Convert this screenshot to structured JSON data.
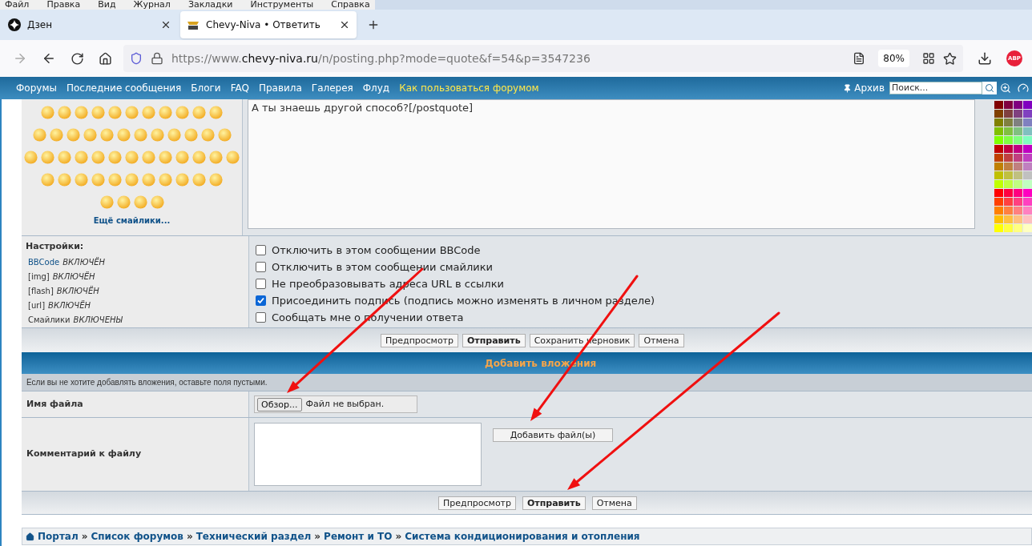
{
  "browser": {
    "menu": [
      "Файл",
      "Правка",
      "Вид",
      "Журнал",
      "Закладки",
      "Инструменты",
      "Справка"
    ],
    "tabs": [
      {
        "title": "Дзен",
        "selected": false
      },
      {
        "title": "Chevy-Niva • Ответить",
        "selected": true
      }
    ],
    "url": {
      "prefix": "https://www.",
      "domain": "chevy-niva.ru",
      "path": "/n/posting.php?mode=quote&f=54&p=3547236"
    },
    "zoom": "80%",
    "extension": "ABP"
  },
  "nav": {
    "links": [
      {
        "label": "Форумы",
        "highlight": false
      },
      {
        "label": "Последние сообщения",
        "highlight": false
      },
      {
        "label": "Блоги",
        "highlight": false
      },
      {
        "label": "FAQ",
        "highlight": false
      },
      {
        "label": "Правила",
        "highlight": false
      },
      {
        "label": "Галерея",
        "highlight": false
      },
      {
        "label": "Флуд",
        "highlight": false
      },
      {
        "label": "Как пользоваться форумом",
        "highlight": true
      }
    ],
    "archive": "Архив",
    "search": {
      "placeholder": "Поиск..."
    }
  },
  "smilies": {
    "more": "Ещё смайлики..."
  },
  "message": {
    "text": "А ты знаешь другой способ?[/postquote]"
  },
  "settings": {
    "title": "Настройки:",
    "items": [
      {
        "name": "BBCode",
        "value": "ВКЛЮЧЁН",
        "link": true
      },
      {
        "name": "[img]",
        "value": "ВКЛЮЧЁН",
        "link": false
      },
      {
        "name": "[flash]",
        "value": "ВКЛЮЧЁН",
        "link": false
      },
      {
        "name": "[url]",
        "value": "ВКЛЮЧЁН",
        "link": false
      },
      {
        "name": "Смайлики",
        "value": "ВКЛЮЧЕНЫ",
        "link": false
      }
    ],
    "options": [
      {
        "label": "Отключить в этом сообщении BBCode",
        "checked": false
      },
      {
        "label": "Отключить в этом сообщении смайлики",
        "checked": false
      },
      {
        "label": "Не преобразовывать адреса URL в ссылки",
        "checked": false
      },
      {
        "label": "Присоединить подпись (подпись можно изменять в личном разделе)",
        "checked": true
      },
      {
        "label": "Сообщать мне о получении ответа",
        "checked": false
      }
    ]
  },
  "buttons": [
    {
      "label": "Предпросмотр",
      "primary": false
    },
    {
      "label": "Отправить",
      "primary": true
    },
    {
      "label": "Сохранить черновик",
      "primary": false
    },
    {
      "label": "Отмена",
      "primary": false
    }
  ],
  "attachments": {
    "title": "Добавить вложения",
    "hint": "Если вы не хотите добавлять вложения, оставьте поля пустыми.",
    "file_label": "Имя файла",
    "browse": "Обзор...",
    "no_file": "Файл не выбран.",
    "comment_label": "Комментарий к файлу",
    "add": "Добавить файл(ы)",
    "buttons": [
      {
        "label": "Предпросмотр",
        "primary": false
      },
      {
        "label": "Отправить",
        "primary": true
      },
      {
        "label": "Отмена",
        "primary": false
      }
    ]
  },
  "breadcrumbs": {
    "separator": "»",
    "items": [
      "Портал",
      "Список форумов",
      "Технический раздел",
      "Ремонт и ТО",
      "Система кондиционирования и отопления"
    ]
  }
}
